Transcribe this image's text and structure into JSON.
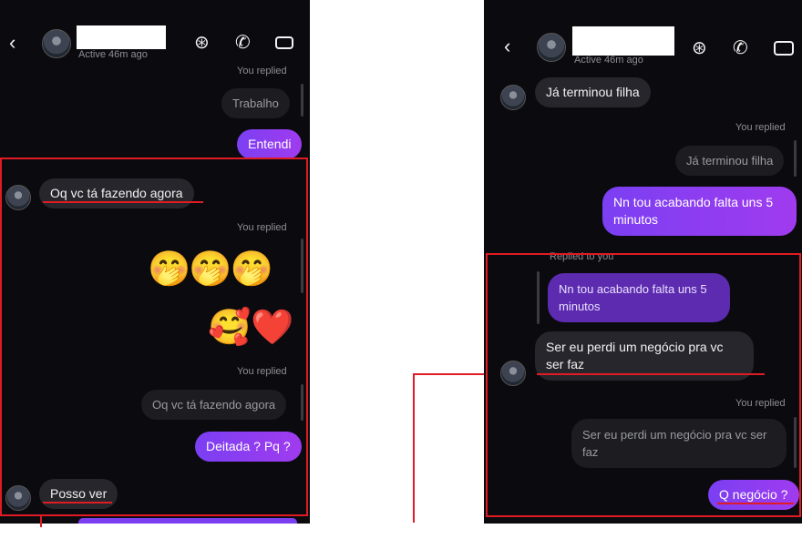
{
  "left": {
    "active_status": "Active 46m ago",
    "messages": {
      "you_replied_1": "You replied",
      "trabalho": "Trabalho",
      "entendi": "Entendi",
      "oq_vc": "Oq vc tá fazendo agora",
      "you_replied_2": "You replied",
      "emoji_row1": "🤭🤭🤭",
      "emoji_row2": "🥰❤️",
      "you_replied_3": "You replied",
      "quoted_oq": "Oq vc tá fazendo agora",
      "deitada": "Deitada ? Pq ?",
      "posso_ver": "Posso ver"
    }
  },
  "right": {
    "active_status": "Active 46m ago",
    "messages": {
      "ja_terminou": "Já terminou filha",
      "you_replied_1": "You replied",
      "quoted_ja": "Já terminou filha",
      "nn_tou": "Nn tou acabando falta uns 5 minutos",
      "replied_to_you": "Replied to you",
      "quoted_nn": "Nn tou acabando falta uns 5 minutos",
      "ser_eu": "Ser eu perdi um negócio pra vc ser faz",
      "you_replied_2": "You replied",
      "quoted_ser": "Ser eu perdi um negócio pra vc ser faz",
      "q_negocio": "Q negócio ?"
    }
  },
  "icons": {
    "back": "chevron-left-icon",
    "video": "video-camera-icon",
    "phone": "phone-icon",
    "effects": "sticker-icon"
  },
  "colors": {
    "background": "#0b0b0f",
    "incoming": "#26262c",
    "outgoing": "#8a3bf0",
    "highlight": "#e01b24"
  }
}
